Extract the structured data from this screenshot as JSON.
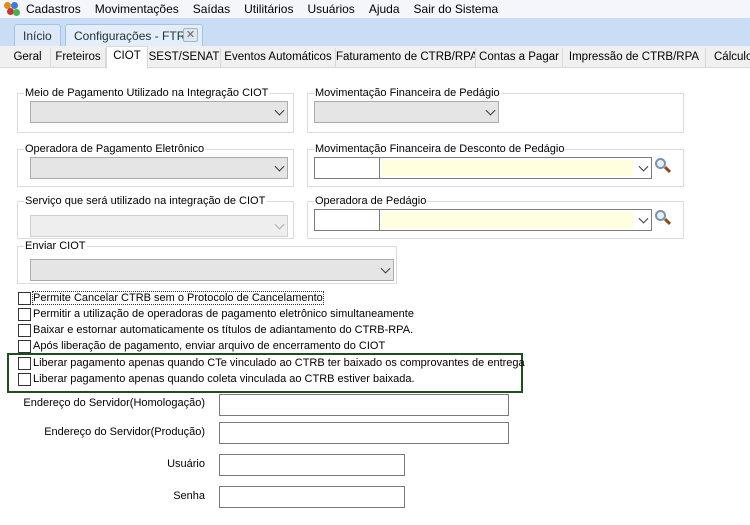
{
  "menu": [
    "Cadastros",
    "Movimentações",
    "Saídas",
    "Utilitários",
    "Usuários",
    "Ajuda",
    "Sair do Sistema"
  ],
  "window_tabs": {
    "home": "Início",
    "config": "Configurações - FTR"
  },
  "subtabs": [
    "Geral",
    "Freteiros",
    "CIOT",
    "SEST/SENAT",
    "Eventos Automáticos",
    "Faturamento de CTRB/RPA",
    "Contas a Pagar",
    "Impressão de CTRB/RPA",
    "Cálculo"
  ],
  "groups": {
    "meio_pagamento": "Meio de Pagamento Utilizado na Integração CIOT",
    "mov_pedagio": "Movimentação Financeira de Pedágio",
    "operadora_pagamento": "Operadora de Pagamento Eletrônico",
    "mov_desconto_pedagio": "Movimentação Financeira de Desconto de  Pedágio",
    "servico": "Serviço que será utilizado na integração de CIOT",
    "operadora_pedagio": "Operadora de Pedágio",
    "enviar_ciot": "Enviar CIOT"
  },
  "checkboxes": [
    {
      "label": "Permite Cancelar CTRB sem o Protocolo de Cancelamento",
      "checked": false
    },
    {
      "label": "Permitir a utilização de operadoras de pagamento eletrônico simultaneamente",
      "checked": false
    },
    {
      "label": "Baixar e estornar automaticamente os títulos de adiantamento do CTRB-RPA.",
      "checked": false
    },
    {
      "label": "Após liberação de pagamento, enviar arquivo de encerramento do CIOT",
      "checked": false
    },
    {
      "label": "Liberar pagamento apenas quando CTe vinculado ao CTRB ter baixado os comprovantes de entrega",
      "checked": false
    },
    {
      "label": "Liberar pagamento apenas quando coleta vinculada ao CTRB estiver baixada.",
      "checked": false
    }
  ],
  "fields": {
    "homologacao": "Endereço do Servidor(Homologação)",
    "producao": "Endereço do Servidor(Produção)",
    "usuario": "Usuário",
    "senha": "Senha"
  },
  "colors": {
    "highlight_border": "#1e4d1e",
    "tabstrip": "#c9ddf4",
    "lookup_fill": "#ffffe0"
  }
}
